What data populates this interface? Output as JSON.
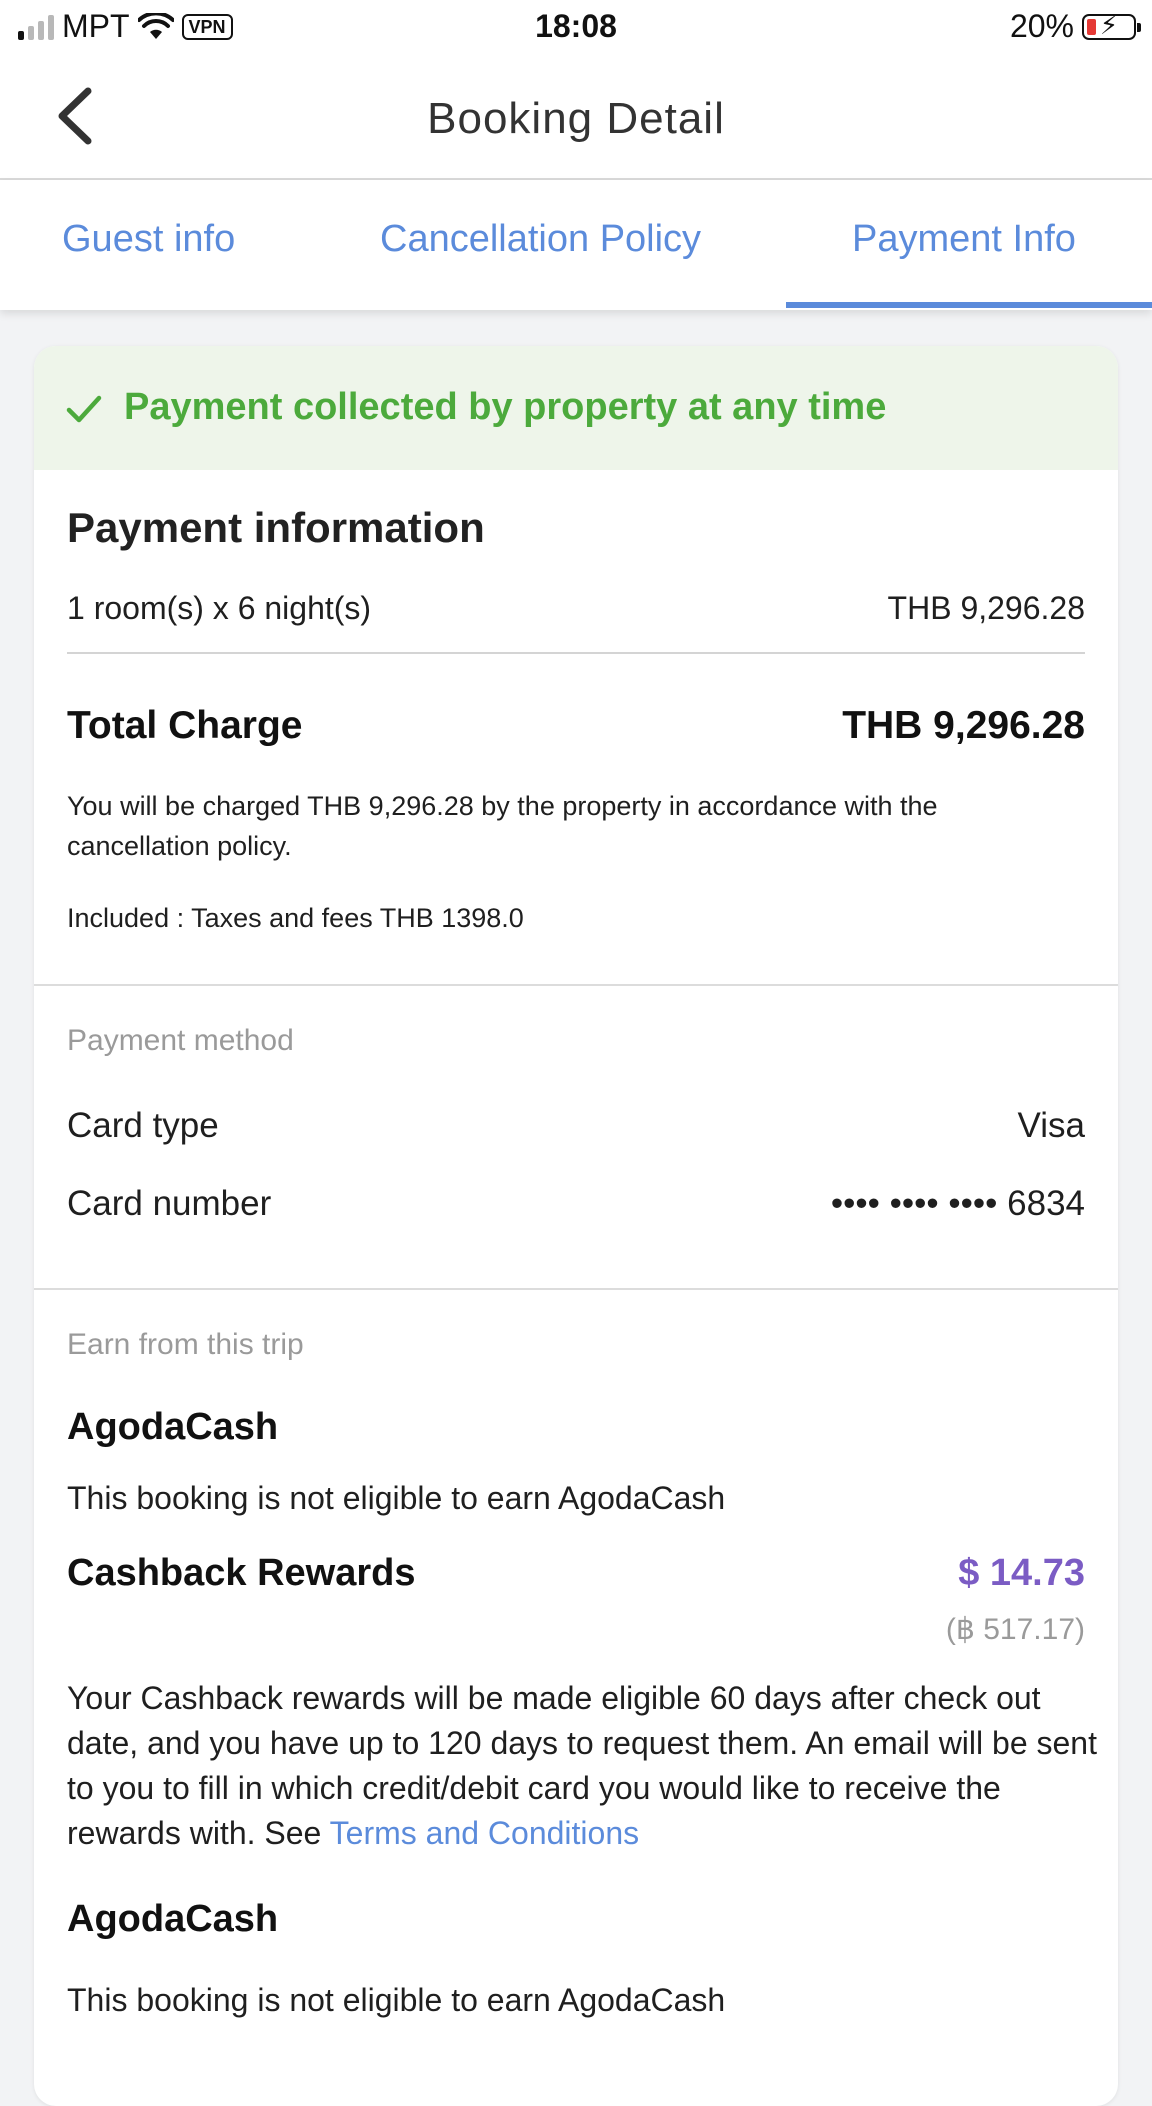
{
  "status_bar": {
    "carrier": "MPT",
    "vpn": "VPN",
    "time": "18:08",
    "battery_percent": "20%",
    "battery_level": 0.2
  },
  "header": {
    "title": "Booking Detail",
    "back_icon": "chevron-left-icon"
  },
  "tabs": [
    {
      "label": "Guest info",
      "active": false
    },
    {
      "label": "Cancellation Policy",
      "active": false
    },
    {
      "label": "Payment Info",
      "active": true
    }
  ],
  "banner": {
    "icon": "checkmark-icon",
    "text": "Payment collected by property at any time",
    "color": "#4caa3c"
  },
  "payment_information": {
    "title": "Payment information",
    "room_line_label": "1 room(s) x 6 night(s)",
    "room_line_value": "THB 9,296.28",
    "total_label": "Total Charge",
    "total_value": "THB 9,296.28",
    "charge_note": "You will be charged THB 9,296.28 by the property in accordance with the cancellation policy.",
    "included_note": "Included : Taxes and fees THB 1398.0"
  },
  "payment_method": {
    "section_label": "Payment method",
    "card_type_label": "Card type",
    "card_type_value": "Visa",
    "card_number_label": "Card number",
    "card_number_value": "•••• •••• •••• 6834"
  },
  "earn": {
    "section_label": "Earn from this trip",
    "agodacash_title": "AgodaCash",
    "agodacash_note": "This booking is not eligible to earn AgodaCash",
    "cashback_title": "Cashback Rewards",
    "cashback_value": "$ 14.73",
    "cashback_sub": "(฿ 517.17)",
    "cashback_paragraph": "Your Cashback rewards will be made eligible 60 days after check out date, and you have up to 120 days to request them. An email will be sent to you to fill in which credit/debit card you would like to receive the rewards with. See ",
    "terms_link": "Terms and Conditions",
    "agodacash_title_2": "AgodaCash",
    "agodacash_note_2": "This booking is not eligible to earn AgodaCash"
  },
  "colors": {
    "accent_blue": "#5b8bdb",
    "success_green": "#4caa3c",
    "cashback_purple": "#7b5cc4"
  }
}
